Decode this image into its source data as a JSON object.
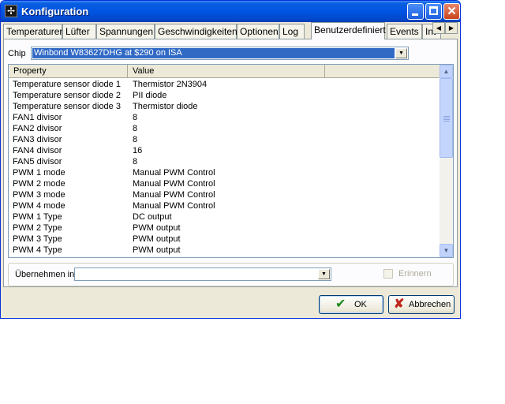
{
  "window": {
    "title": "Konfiguration"
  },
  "tabs": [
    {
      "label": "Temperaturen"
    },
    {
      "label": "Lüfter"
    },
    {
      "label": "Spannungen"
    },
    {
      "label": "Geschwindigkeiten"
    },
    {
      "label": "Optionen"
    },
    {
      "label": "Log"
    },
    {
      "label": "Benutzerdefiniert"
    },
    {
      "label": "Events"
    },
    {
      "label": "Int"
    }
  ],
  "active_tab": "Benutzerdefiniert",
  "chip": {
    "label": "Chip",
    "value": "Winbond W83627DHG at $290 on ISA"
  },
  "table": {
    "columns": [
      "Property",
      "Value"
    ],
    "rows": [
      [
        "Temperature sensor diode 1",
        "Thermistor 2N3904"
      ],
      [
        "Temperature sensor diode 2",
        "PII diode"
      ],
      [
        "Temperature sensor diode 3",
        "Thermistor diode"
      ],
      [
        "FAN1 divisor",
        "8"
      ],
      [
        "FAN2 divisor",
        "8"
      ],
      [
        "FAN3 divisor",
        "8"
      ],
      [
        "FAN4 divisor",
        "16"
      ],
      [
        "FAN5 divisor",
        "8"
      ],
      [
        "PWM 1 mode",
        "Manual PWM Control"
      ],
      [
        "PWM 2 mode",
        "Manual PWM Control"
      ],
      [
        "PWM 3 mode",
        "Manual PWM Control"
      ],
      [
        "PWM 4 mode",
        "Manual PWM Control"
      ],
      [
        "PWM 1 Type",
        "DC output"
      ],
      [
        "PWM 2 Type",
        "PWM output"
      ],
      [
        "PWM 3 Type",
        "PWM output"
      ],
      [
        "PWM 4 Type",
        "PWM output"
      ]
    ]
  },
  "apply": {
    "label": "Übernehmen in",
    "value": ""
  },
  "remember": {
    "label": "Erinnern",
    "checked": false,
    "enabled": false
  },
  "buttons": {
    "ok": "OK",
    "cancel": "Abbrechen"
  },
  "icons": {
    "app": "fan-icon",
    "ok": "checkmark-icon",
    "cancel": "x-icon",
    "colors": {
      "titlebar": "#0054e3",
      "selection": "#316ac5",
      "ok_check": "#1a8a1a",
      "cancel_x": "#c0281c"
    }
  }
}
